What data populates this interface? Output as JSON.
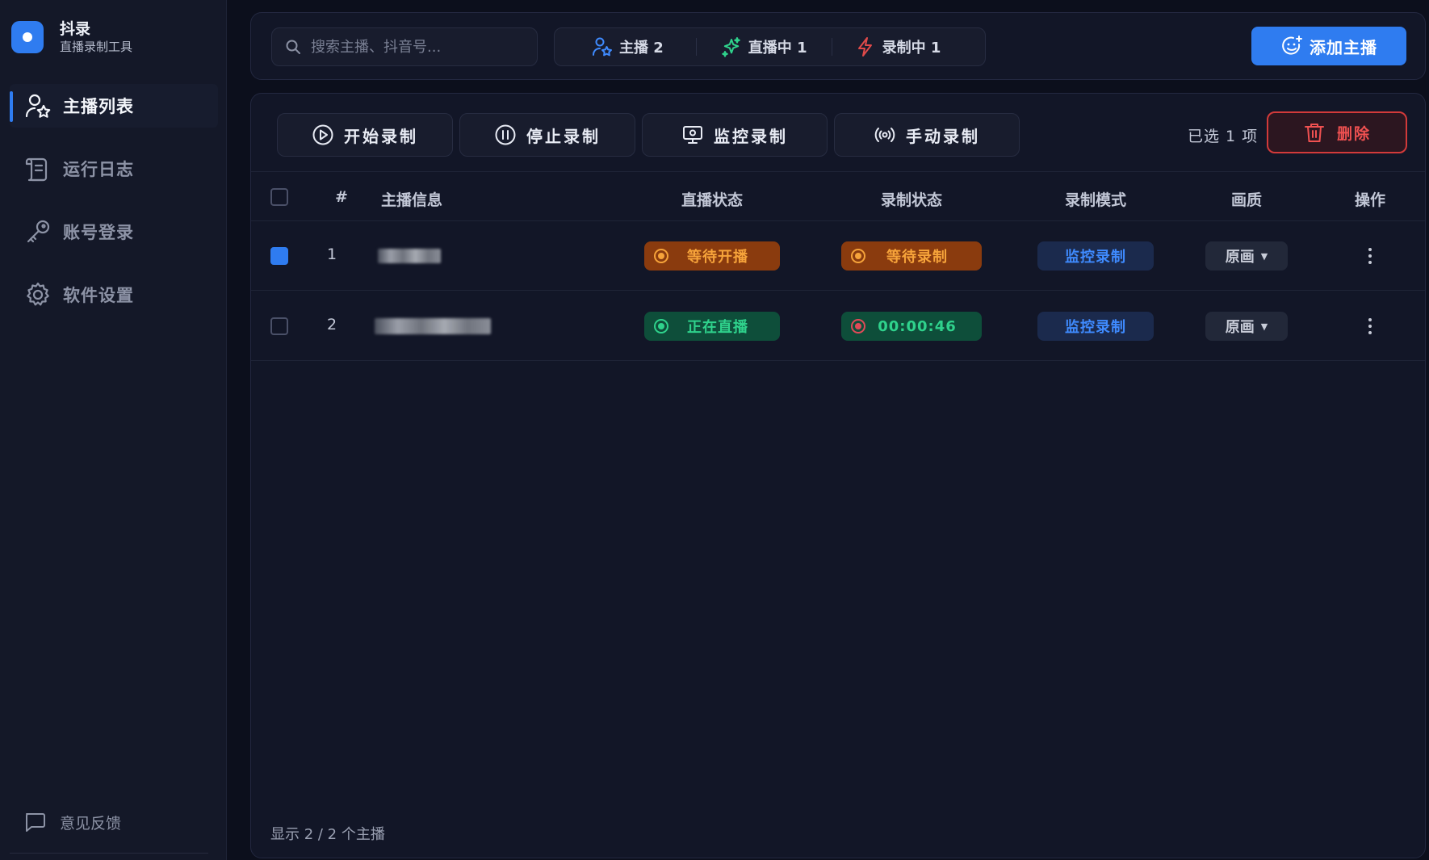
{
  "app": {
    "name": "抖录",
    "subtitle": "直播录制工具",
    "accent": "#2f7cf0"
  },
  "sidebar": {
    "items": [
      {
        "label": "主播列表",
        "icon": "users-icon",
        "active": true
      },
      {
        "label": "运行日志",
        "icon": "scroll-icon",
        "active": false
      },
      {
        "label": "账号登录",
        "icon": "key-icon",
        "active": false
      },
      {
        "label": "软件设置",
        "icon": "gear-icon",
        "active": false
      }
    ],
    "feedback": {
      "label": "意见反馈",
      "icon": "chat-icon"
    }
  },
  "topbar": {
    "search": {
      "placeholder": "搜索主播、抖音号...",
      "value": ""
    },
    "stats": [
      {
        "label": "主播 2",
        "icon": "streamer-icon",
        "color": "#3f8bff"
      },
      {
        "label": "直播中 1",
        "icon": "sparkle-icon",
        "color": "#2fd28c"
      },
      {
        "label": "录制中 1",
        "icon": "lightning-icon",
        "color": "#e04a4a"
      }
    ],
    "add_button": {
      "label": "添加主播",
      "icon": "add-user-icon"
    }
  },
  "toolbar": {
    "buttons": [
      {
        "label": "开始录制",
        "icon": "play-icon"
      },
      {
        "label": "停止录制",
        "icon": "pause-icon"
      },
      {
        "label": "监控录制",
        "icon": "monitor-icon"
      },
      {
        "label": "手动录制",
        "icon": "broadcast-icon"
      }
    ],
    "selected_text": "已选 1 项",
    "delete_label": "删除"
  },
  "table": {
    "columns": [
      "#",
      "主播信息",
      "直播状态",
      "录制状态",
      "录制模式",
      "画质",
      "操作"
    ],
    "rows": [
      {
        "index": "1",
        "checked": true,
        "live_status": "等待开播",
        "live_color": "orange",
        "record_status": "等待录制",
        "record_color": "orange",
        "mode": "监控录制",
        "quality": "原画"
      },
      {
        "index": "2",
        "checked": false,
        "live_status": "正在直播",
        "live_color": "green",
        "record_status": "00:00:46",
        "record_color": "green",
        "mode": "监控录制",
        "quality": "原画"
      }
    ]
  },
  "footer": {
    "count_text": "显示 2 / 2 个主播"
  }
}
